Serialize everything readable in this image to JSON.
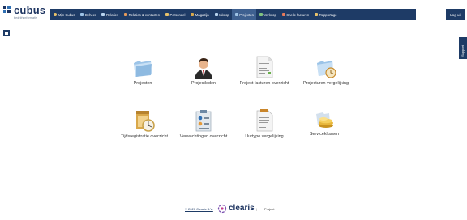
{
  "brand": {
    "name": "cubus",
    "tagline": "bedrijfsinformatie"
  },
  "nav": {
    "items": [
      {
        "label": "Mijn Cubus",
        "icon": "user-icon",
        "color": "#e8c26a"
      },
      {
        "label": "Beheer",
        "icon": "wrench-icon",
        "color": "#9ec3e6"
      },
      {
        "label": "Relaties",
        "icon": "people-icon",
        "color": "#b9d4ef"
      },
      {
        "label": "Relaties & contacten",
        "icon": "contacts-icon",
        "color": "#e79a5a"
      },
      {
        "label": "Personeel",
        "icon": "staff-icon",
        "color": "#e8c26a"
      },
      {
        "label": "Magazijn",
        "icon": "warehouse-icon",
        "color": "#d9a84a"
      },
      {
        "label": "Inkoop",
        "icon": "purchase-icon",
        "color": "#b9d4ef"
      },
      {
        "label": "Projecten",
        "icon": "projects-icon",
        "color": "#9ec3e6",
        "active": true
      },
      {
        "label": "Verkoop",
        "icon": "sales-icon",
        "color": "#7fc27f"
      },
      {
        "label": "Snelle facturen",
        "icon": "invoice-icon",
        "color": "#e77a5a"
      },
      {
        "label": "Rapportage",
        "icon": "report-icon",
        "color": "#e8c26a"
      }
    ],
    "logout": "Log uit"
  },
  "support": {
    "label": "Support"
  },
  "modules": {
    "projecten": "Projecten",
    "projectleden": "Projectleden",
    "project_facturen": "Project facturen overzicht",
    "projecturen": "Projecturen vergelijking",
    "tijdsregistratie": "Tijdsregistratie overzicht",
    "verwachtingen": "Verwachtingen overzicht",
    "uurtype": "Uurtype vergelijking",
    "serviceklussen": "Serviceklussen"
  },
  "footer": {
    "copyright": "© 2020 Clearis B.V.",
    "company": "clearis",
    "separator": "|",
    "product": "Project"
  },
  "colors": {
    "navbar": "#1e3b66",
    "active_tab": "#3e6090",
    "brand": "#1c3360"
  }
}
